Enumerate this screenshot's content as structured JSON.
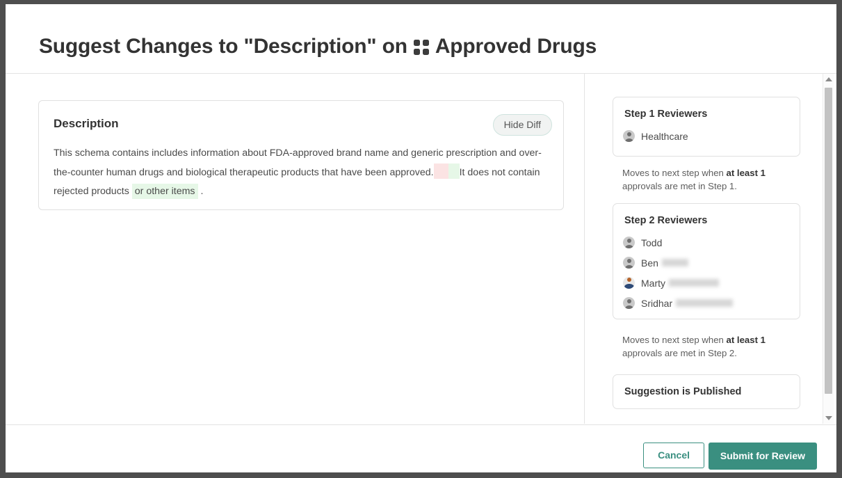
{
  "header": {
    "title_before": "Suggest Changes to \"Description\" on",
    "icon": "grid-icon",
    "title_after": "Approved  Drugs"
  },
  "description_card": {
    "title": "Description",
    "hide_diff_label": "Hide Diff",
    "text_part_1": "This schema contains includes information about FDA-approved brand name and generic prescription and over-the-counter human drugs and biological therapeutic products that have been approved.",
    "deleted_space": " ",
    "inserted_space": " ",
    "text_part_2": "It does not contain rejected products",
    "inserted_text": "or other items",
    "text_part_3": "."
  },
  "sidebar": {
    "step1": {
      "title": "Step 1 Reviewers",
      "reviewers": [
        {
          "name": "Healthcare",
          "redacted_width": 0,
          "avatar": "default-avatar-icon"
        }
      ],
      "note_prefix": "Moves to next step when ",
      "note_bold": "at least 1",
      "note_suffix": " approvals are met in Step 1."
    },
    "step2": {
      "title": "Step 2 Reviewers",
      "reviewers": [
        {
          "name": "Todd",
          "redacted_width": 0,
          "avatar": "default-avatar-icon"
        },
        {
          "name": "Ben",
          "redacted_width": 38,
          "avatar": "default-avatar-icon"
        },
        {
          "name": "Marty",
          "redacted_width": 72,
          "avatar": "photo-avatar-icon"
        },
        {
          "name": "Sridhar",
          "redacted_width": 82,
          "avatar": "default-avatar-icon"
        }
      ],
      "note_prefix": "Moves to next step when ",
      "note_bold": "at least 1",
      "note_suffix": " approvals are met in Step 2."
    },
    "published": {
      "label": "Suggestion is Published"
    }
  },
  "footer": {
    "cancel_label": "Cancel",
    "submit_label": "Submit for Review"
  },
  "colors": {
    "accent_teal": "#3a8f80",
    "diff_insert_green": "#e6f7e7",
    "diff_delete_pink": "#fbe3e3",
    "window_chrome": "#4e4e4e"
  }
}
